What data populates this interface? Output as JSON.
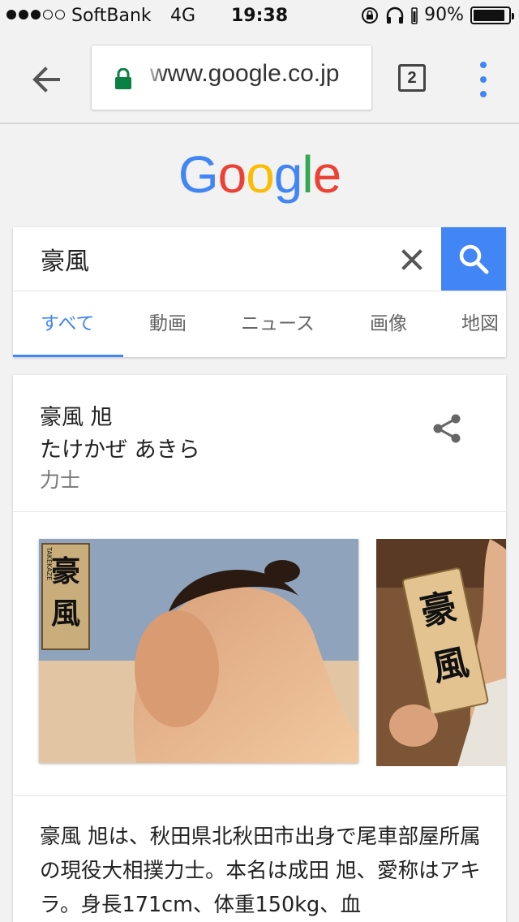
{
  "status_bar": {
    "carrier": "SoftBank",
    "network": "4G",
    "time": "19:38",
    "battery": "90%",
    "battery_level": 0.9,
    "signal_bars": 3,
    "signal_total": 5
  },
  "browser": {
    "url": "www.google.co.jp",
    "tab_count": "2",
    "accent_color": "#4285f4",
    "secure_color": "#0b8043"
  },
  "logo": {
    "letters": [
      "G",
      "o",
      "o",
      "g",
      "l",
      "e"
    ],
    "colors": [
      "#4285f4",
      "#ea4335",
      "#fbbc05",
      "#4285f4",
      "#34a853",
      "#ea4335"
    ]
  },
  "search": {
    "query": "豪風"
  },
  "tabs": [
    {
      "label": "すべて",
      "active": true
    },
    {
      "label": "動画",
      "active": false
    },
    {
      "label": "ニュース",
      "active": false
    },
    {
      "label": "画像",
      "active": false
    },
    {
      "label": "地図",
      "active": false
    }
  ],
  "knowledge_panel": {
    "title": "豪風 旭",
    "reading": "たけかぜ あきら",
    "type": "力士",
    "image1_caption": "豪風",
    "image1_subtitle": "TAKEKAZE",
    "image2_caption": "豪風",
    "description": "豪風 旭は、秋田県北秋田市出身で尾車部屋所属の現役大相撲力士。本名は成田 旭、愛称はアキラ。身長171cm、体重150kg、血"
  }
}
